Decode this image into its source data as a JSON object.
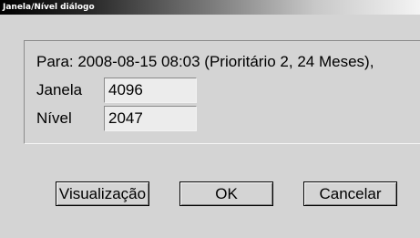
{
  "window": {
    "title": "Janela/Nível diálogo"
  },
  "info": {
    "text": "Para: 2008-08-15 08:03 (Prioritário 2, 24 Meses),"
  },
  "fields": {
    "janela_label": "Janela",
    "janela_value": "4096",
    "nivel_label": "Nível",
    "nivel_value": "2047"
  },
  "buttons": {
    "preview_label": "Visualização",
    "ok_label": "OK",
    "cancel_label": "Cancelar"
  }
}
